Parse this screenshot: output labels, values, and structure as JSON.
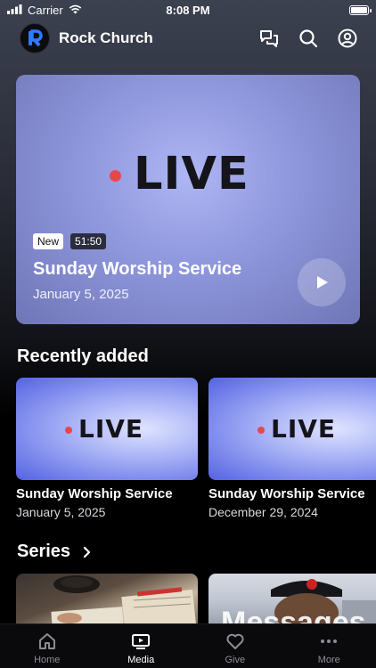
{
  "status_bar": {
    "carrier": "Carrier",
    "time": "8:08 PM"
  },
  "header": {
    "app_title": "Rock Church",
    "logo_letter": "R",
    "icons": [
      "chat-icon",
      "search-icon",
      "profile-icon"
    ]
  },
  "hero": {
    "live_text": "LIVE",
    "badge_new": "New",
    "duration": "51:50",
    "title": "Sunday Worship Service",
    "date": "January 5, 2025"
  },
  "recently_added": {
    "title": "Recently added",
    "items": [
      {
        "live_text": "LIVE",
        "title": "Sunday Worship Service",
        "date": "January 5, 2025"
      },
      {
        "live_text": "LIVE",
        "title": "Sunday Worship Service",
        "date": "December 29, 2024"
      }
    ]
  },
  "series": {
    "title": "Series",
    "items": [
      {
        "overlay_text": ""
      },
      {
        "overlay_text": "Messages"
      }
    ]
  },
  "tab_bar": {
    "tabs": [
      {
        "label": "Home",
        "icon": "home-icon"
      },
      {
        "label": "Media",
        "icon": "media-icon",
        "active": true
      },
      {
        "label": "Give",
        "icon": "heart-icon"
      },
      {
        "label": "More",
        "icon": "more-icon"
      }
    ]
  },
  "colors": {
    "live_dot": "#e8474a",
    "hero_bg": "#8e96dc",
    "card_bg": "#5463e3"
  }
}
